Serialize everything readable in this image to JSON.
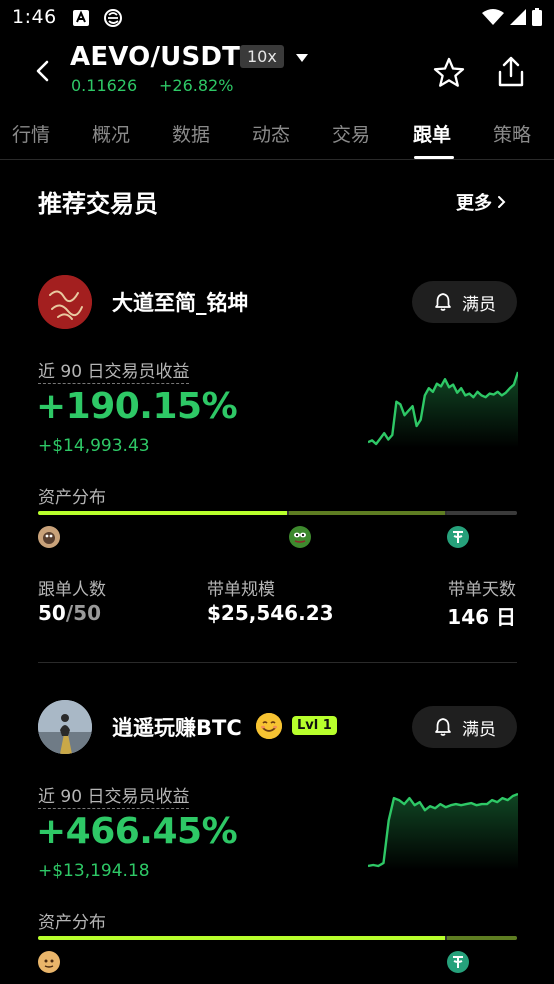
{
  "status": {
    "time": "1:46"
  },
  "header": {
    "pair": "AEVO/USDT",
    "leverage": "10x",
    "price": "0.11626",
    "change": "+26.82%"
  },
  "tabs": [
    "行情",
    "概况",
    "数据",
    "动态",
    "交易",
    "跟单",
    "策略"
  ],
  "active_tab": "跟单",
  "section": {
    "title": "推荐交易员",
    "more": "更多"
  },
  "traders": [
    {
      "name": "大道至简_铭坤",
      "full_label": "满员",
      "ret_label": "近 90 日交易员收益",
      "ret_pct": "+190.15%",
      "ret_amt": "+$14,993.43",
      "dist_label": "资产分布",
      "distribution": [
        0.52,
        0.33,
        0.15
      ],
      "followers_label": "跟单人数",
      "followers": "50",
      "followers_max": "/50",
      "scale_label": "带单规模",
      "scale": "$25,546.23",
      "days_label": "带单天数",
      "days": "146 日",
      "sparkline": [
        10,
        12,
        8,
        14,
        20,
        13,
        18,
        55,
        52,
        40,
        45,
        50,
        28,
        35,
        62,
        70,
        66,
        75,
        72,
        80,
        71,
        74,
        65,
        70,
        62,
        64,
        60,
        66,
        62,
        60,
        64,
        63,
        66,
        62,
        65,
        70,
        74,
        88
      ]
    },
    {
      "name": "逍遥玩赚BTC",
      "level": "Lvl 1",
      "full_label": "满员",
      "ret_label": "近 90 日交易员收益",
      "ret_pct": "+466.45%",
      "ret_amt": "+$13,194.18",
      "dist_label": "资产分布",
      "distribution": [
        0.85,
        0.15
      ],
      "sparkline": [
        5,
        6,
        5,
        8,
        50,
        72,
        70,
        66,
        72,
        65,
        68,
        60,
        64,
        62,
        66,
        63,
        65,
        66,
        65,
        66,
        67,
        65,
        66,
        66,
        70,
        68,
        72,
        70,
        74,
        76
      ]
    }
  ],
  "colors": {
    "green": "#2ec866",
    "lime": "#b8ff2c"
  }
}
